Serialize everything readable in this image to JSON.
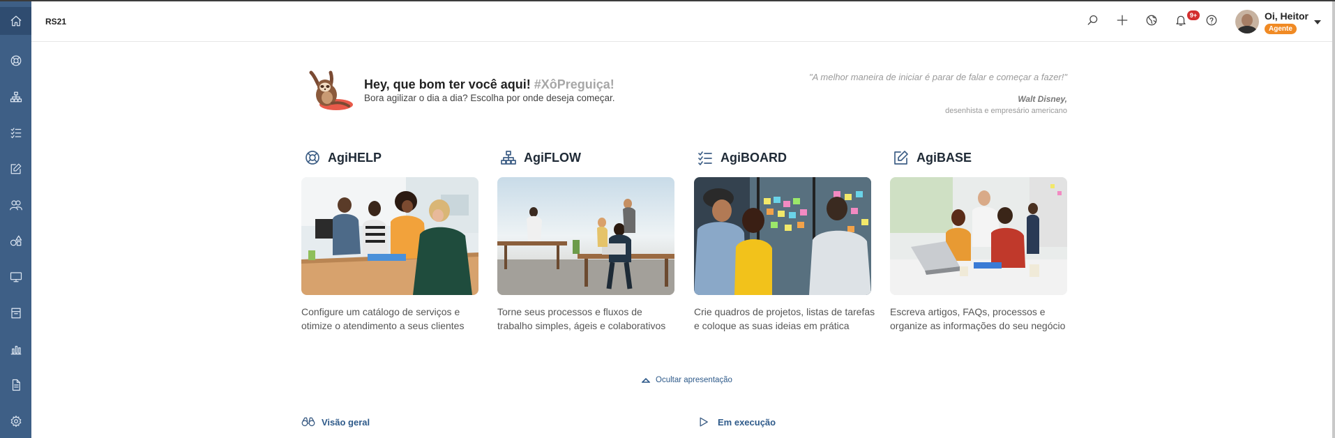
{
  "app": {
    "name": "RS21"
  },
  "header": {
    "notifications_badge": "9+",
    "user": {
      "greeting": "Oi, Heitor",
      "role": "Agente"
    }
  },
  "sidebar": {
    "items": [
      {
        "icon": "home-icon"
      },
      {
        "icon": "lifebuoy-icon"
      },
      {
        "icon": "hierarchy-icon"
      },
      {
        "icon": "checklist-icon"
      },
      {
        "icon": "edit-icon"
      },
      {
        "icon": "users-icon"
      },
      {
        "icon": "shapes-icon"
      },
      {
        "icon": "monitor-icon"
      },
      {
        "icon": "archive-icon"
      },
      {
        "icon": "bar-chart-icon"
      },
      {
        "icon": "document-icon"
      },
      {
        "icon": "gear-icon"
      }
    ]
  },
  "hero": {
    "title": "Hey, que bom ter você aqui!",
    "hashtag": "#XôPreguiça!",
    "subtitle": "Bora agilizar o dia a dia? Escolha por onde deseja começar."
  },
  "quote": {
    "text": "\"A melhor maneira de iniciar é parar de falar e começar a fazer!\"",
    "author": "Walt Disney,",
    "author_desc": "desenhista e empresário americano"
  },
  "cards": [
    {
      "title": "AgiHELP",
      "desc": "Configure um catálogo de serviços e otimize o atendimento a seus clientes"
    },
    {
      "title": "AgiFLOW",
      "desc": "Torne seus processos e fluxos de trabalho simples, ágeis e colaborativos"
    },
    {
      "title": "AgiBOARD",
      "desc": "Crie quadros de projetos, listas de tarefas e coloque as suas ideias em prática"
    },
    {
      "title": "AgiBASE",
      "desc": "Escreva artigos, FAQs, processos e organize as informações do seu negócio"
    }
  ],
  "hide_link": "Ocultar apresentação",
  "sections": {
    "overview": "Visão geral",
    "in_progress": "Em execução"
  },
  "colors": {
    "sidebar": "#3e5f86",
    "accent_link": "#2e5a8a",
    "badge": "#d32f2f",
    "role_badge": "#f08a24"
  }
}
